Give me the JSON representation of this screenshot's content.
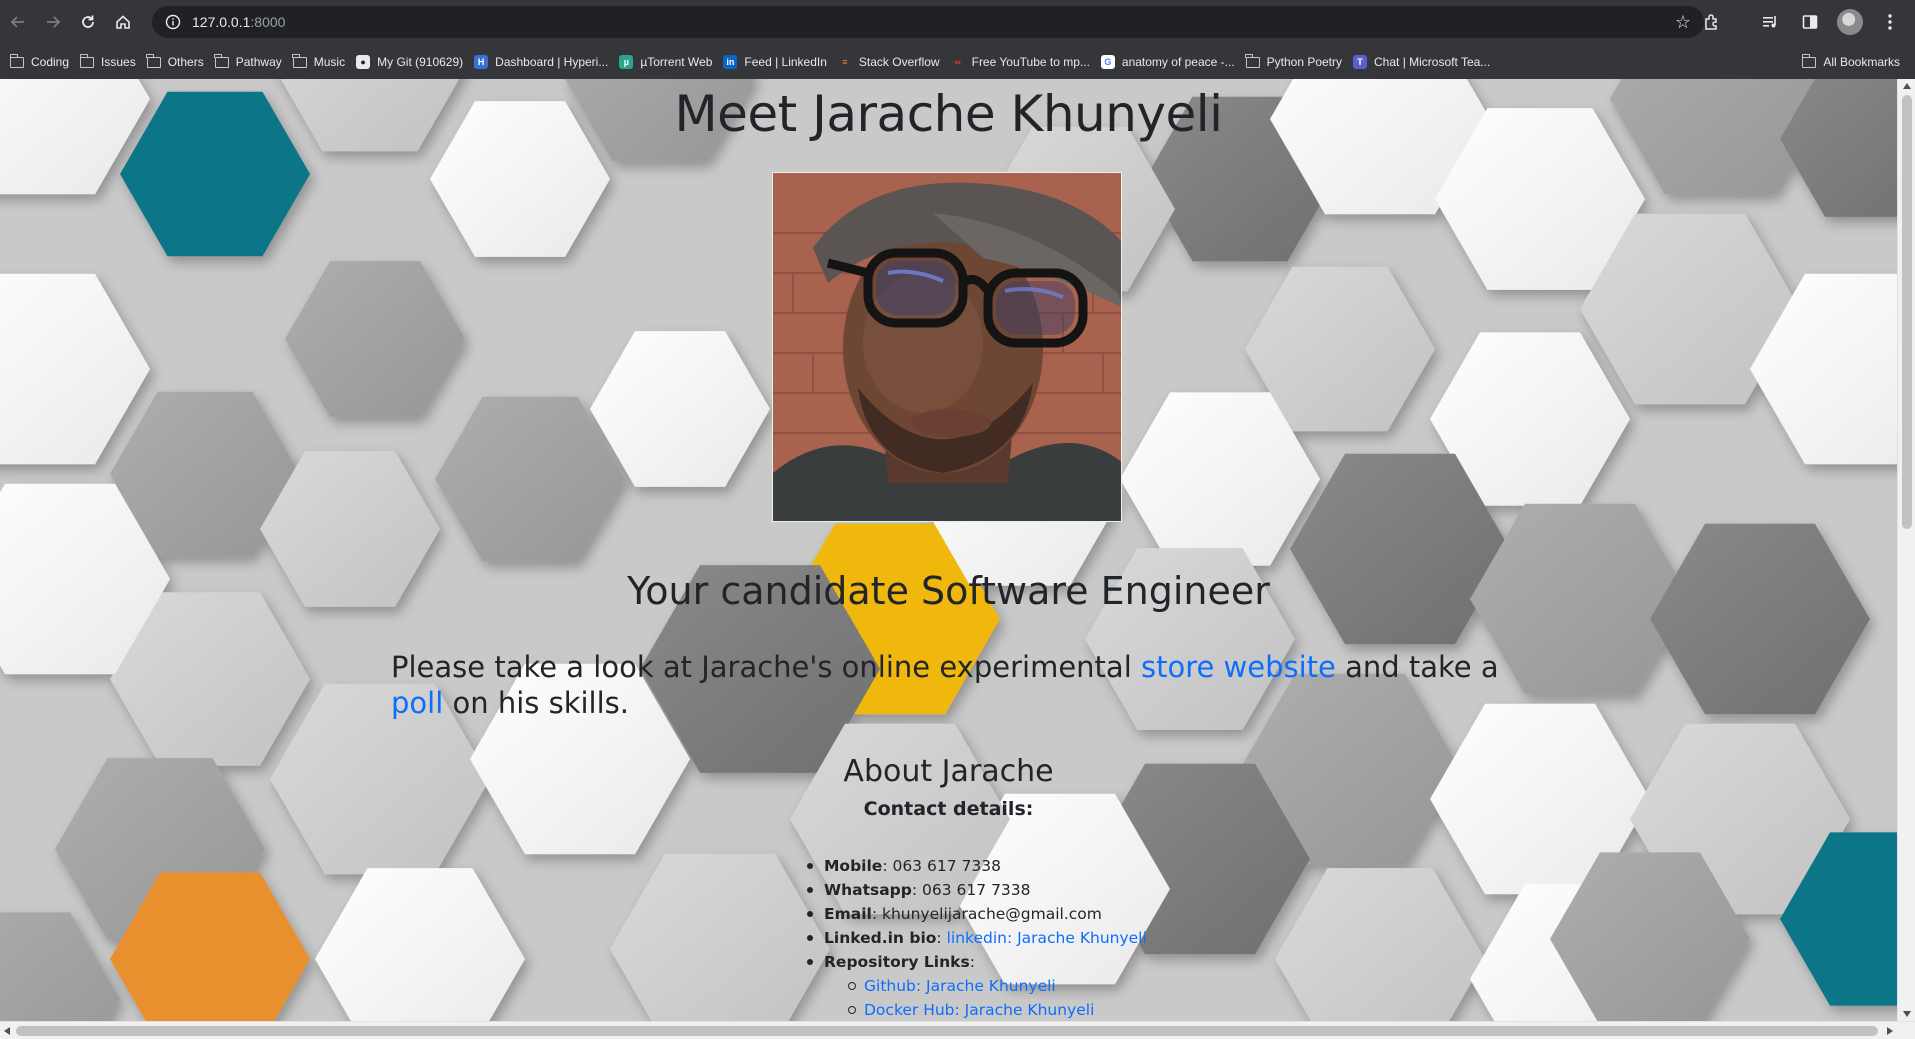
{
  "browser": {
    "url_host": "127.0.0.1",
    "url_port": ":8000",
    "nav": {
      "back_icon": "back-arrow-icon",
      "forward_icon": "forward-arrow-icon",
      "reload_icon": "reload-icon",
      "home_icon": "home-icon"
    },
    "bookmarks": [
      {
        "label": "Coding",
        "type": "folder"
      },
      {
        "label": "Issues",
        "type": "folder"
      },
      {
        "label": "Others",
        "type": "folder"
      },
      {
        "label": "Pathway",
        "type": "folder"
      },
      {
        "label": "Music",
        "type": "folder"
      },
      {
        "label": "My Git (910629)",
        "type": "github"
      },
      {
        "label": "Dashboard | Hyperi...",
        "type": "hyperiondev"
      },
      {
        "label": "µTorrent Web",
        "type": "utorrent"
      },
      {
        "label": "Feed | LinkedIn",
        "type": "linkedin"
      },
      {
        "label": "Stack Overflow",
        "type": "stackoverflow"
      },
      {
        "label": "Free YouTube to mp...",
        "type": "youtube-mp3"
      },
      {
        "label": "anatomy of peace -...",
        "type": "google"
      },
      {
        "label": "Python Poetry",
        "type": "folder"
      },
      {
        "label": "Chat | Microsoft Tea...",
        "type": "teams"
      }
    ],
    "all_bookmarks_label": "All Bookmarks"
  },
  "page": {
    "title": "Meet Jarache Khunyeli",
    "subtitle": "Your candidate Software Engineer",
    "lead_before": "Please take a look at Jarache's online experimental ",
    "lead_link1": "store website",
    "lead_middle": " and take a ",
    "lead_link2": "poll",
    "lead_after": " on his skills.",
    "about_title": "About Jarache",
    "contact_title": "Contact details:",
    "contacts": {
      "mobile_label": "Mobile",
      "mobile_value": ": 063 617 7338",
      "whatsapp_label": "Whatsapp",
      "whatsapp_value": ": 063 617 7338",
      "email_label": "Email",
      "email_value": ": khunyelijarache@gmail.com",
      "linkedin_label": "Linked.in bio",
      "linkedin_sep": ": ",
      "linkedin_link": "linkedin: Jarache Khunyeli",
      "repo_label": "Repository Links",
      "repo_sep": ":",
      "github_link": "Github: Jarache Khunyeli",
      "docker_link": "Docker Hub: Jarache Khunyeli"
    }
  },
  "colors": {
    "link": "#0d6efd",
    "text": "#212529",
    "hex_teal": "#0e7488",
    "hex_orange": "#e8902e",
    "hex_yellow": "#f0b70b"
  }
}
